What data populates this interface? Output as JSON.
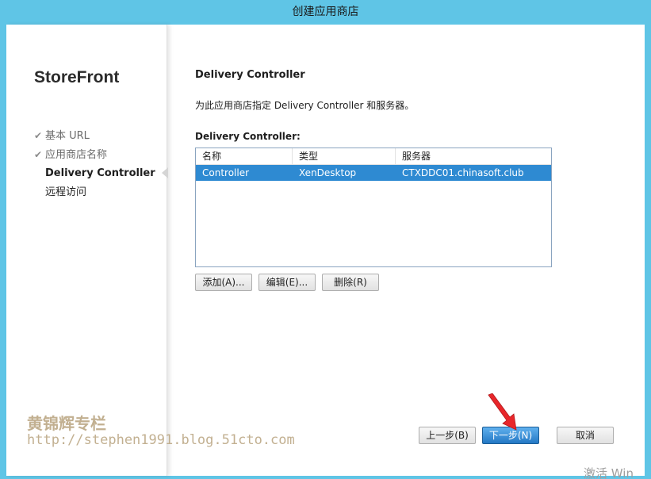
{
  "window": {
    "title": "创建应用商店"
  },
  "sidebar": {
    "brand": "StoreFront",
    "steps": [
      {
        "label": "基本 URL",
        "state": "done"
      },
      {
        "label": "应用商店名称",
        "state": "done"
      },
      {
        "label": "Delivery Controller",
        "state": "active"
      },
      {
        "label": "远程访问",
        "state": "pending"
      }
    ],
    "check_glyph": "✔"
  },
  "main": {
    "heading": "Delivery Controller",
    "description": "为此应用商店指定 Delivery Controller 和服务器。",
    "list_label": "Delivery Controller:",
    "columns": [
      "名称",
      "类型",
      "服务器"
    ],
    "rows": [
      {
        "name": "Controller",
        "type": "XenDesktop",
        "server": "CTXDDC01.chinasoft.club",
        "selected": true
      }
    ],
    "buttons": {
      "add": "添加(A)...",
      "edit": "编辑(E)...",
      "delete": "删除(R)"
    }
  },
  "footer": {
    "back": "上一步(B)",
    "next": "下一步(N)",
    "cancel": "取消"
  },
  "overlay": {
    "watermark_name": "黄锦辉专栏",
    "watermark_url": "http://stephen1991.blog.51cto.com",
    "activate_text": "激活 Win",
    "arrow_color": "#e8262a"
  },
  "colors": {
    "titlebar": "#5fc5e6",
    "selection": "#2e8ad2",
    "primary_button": "#2378c4"
  }
}
